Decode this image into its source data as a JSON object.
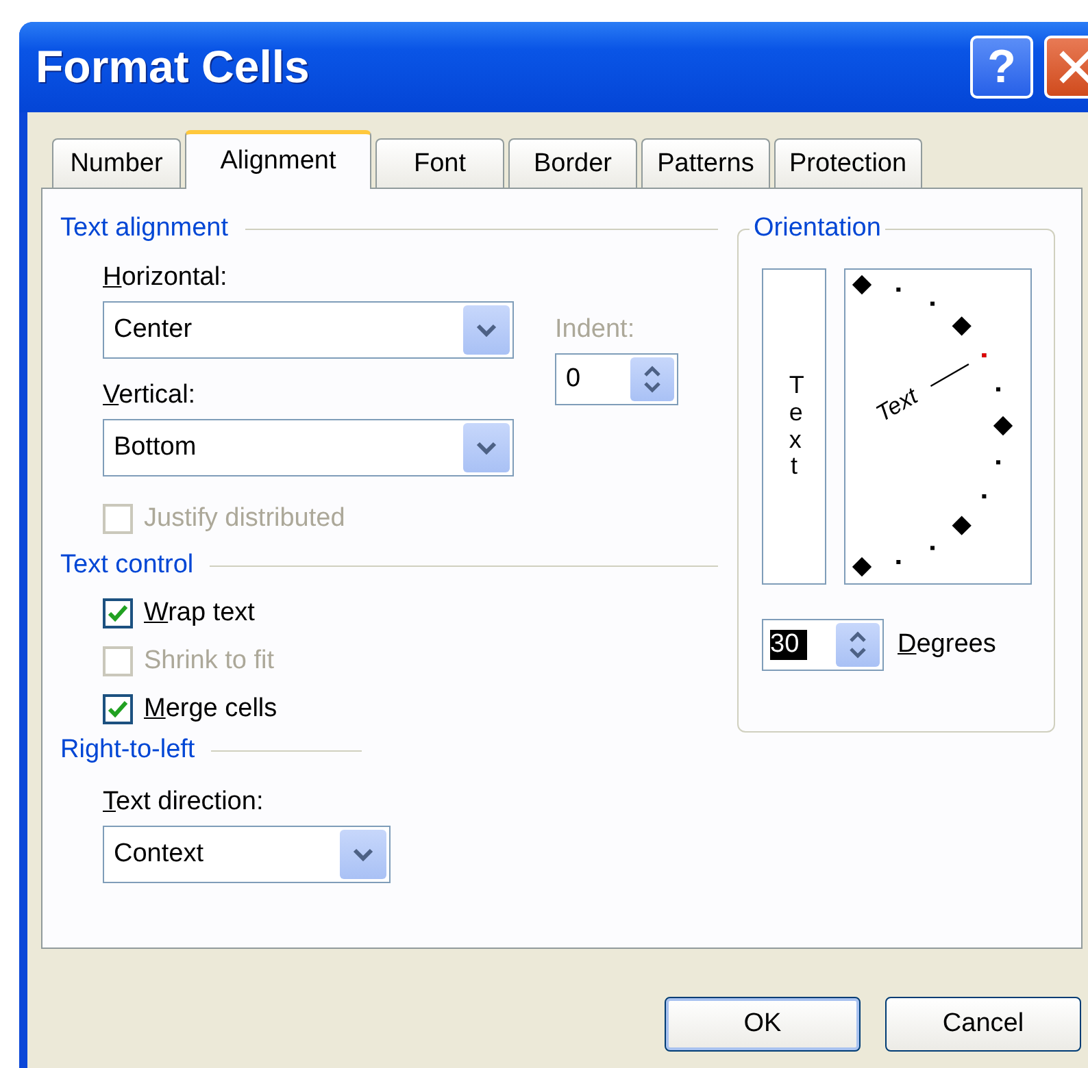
{
  "window": {
    "title": "Format Cells"
  },
  "title_buttons": [
    {
      "kind": "help",
      "label": "?"
    },
    {
      "kind": "close"
    }
  ],
  "tabs": [
    {
      "label": "Number",
      "selected": false
    },
    {
      "label": "Alignment",
      "selected": true
    },
    {
      "label": "Font",
      "selected": false
    },
    {
      "label": "Border",
      "selected": false
    },
    {
      "label": "Patterns",
      "selected": false
    },
    {
      "label": "Protection",
      "selected": false
    }
  ],
  "text_alignment": {
    "legend": "Text alignment",
    "horizontal": {
      "label": "Horizontal:",
      "access_key": true,
      "value": "Center"
    },
    "vertical": {
      "label": "Vertical:",
      "access_key": true,
      "value": "Bottom"
    },
    "indent": {
      "label": "Indent:",
      "disabled": true,
      "value": "0"
    },
    "justify_distributed": {
      "label": "Justify distributed",
      "checked": false,
      "disabled": true
    }
  },
  "text_control": {
    "legend": "Text control",
    "options": [
      {
        "label": "Wrap text",
        "checked": true,
        "disabled": false,
        "access_key": true
      },
      {
        "label": "Shrink to fit",
        "checked": false,
        "disabled": true,
        "access_key": false
      },
      {
        "label": "Merge cells",
        "checked": true,
        "disabled": false,
        "access_key": true
      }
    ]
  },
  "right_to_left": {
    "legend": "Right-to-left",
    "text_direction": {
      "label": "Text direction:",
      "access_key": true,
      "value": "Context"
    }
  },
  "orientation": {
    "legend": "Orientation",
    "vertical_text": "Text",
    "dial_text": "Text",
    "degrees": {
      "value": "30",
      "selected": true
    },
    "degrees_label": "Degrees",
    "degrees_access_key": true
  },
  "buttons": [
    {
      "label": "OK",
      "default": true
    },
    {
      "label": "Cancel",
      "default": false
    }
  ]
}
